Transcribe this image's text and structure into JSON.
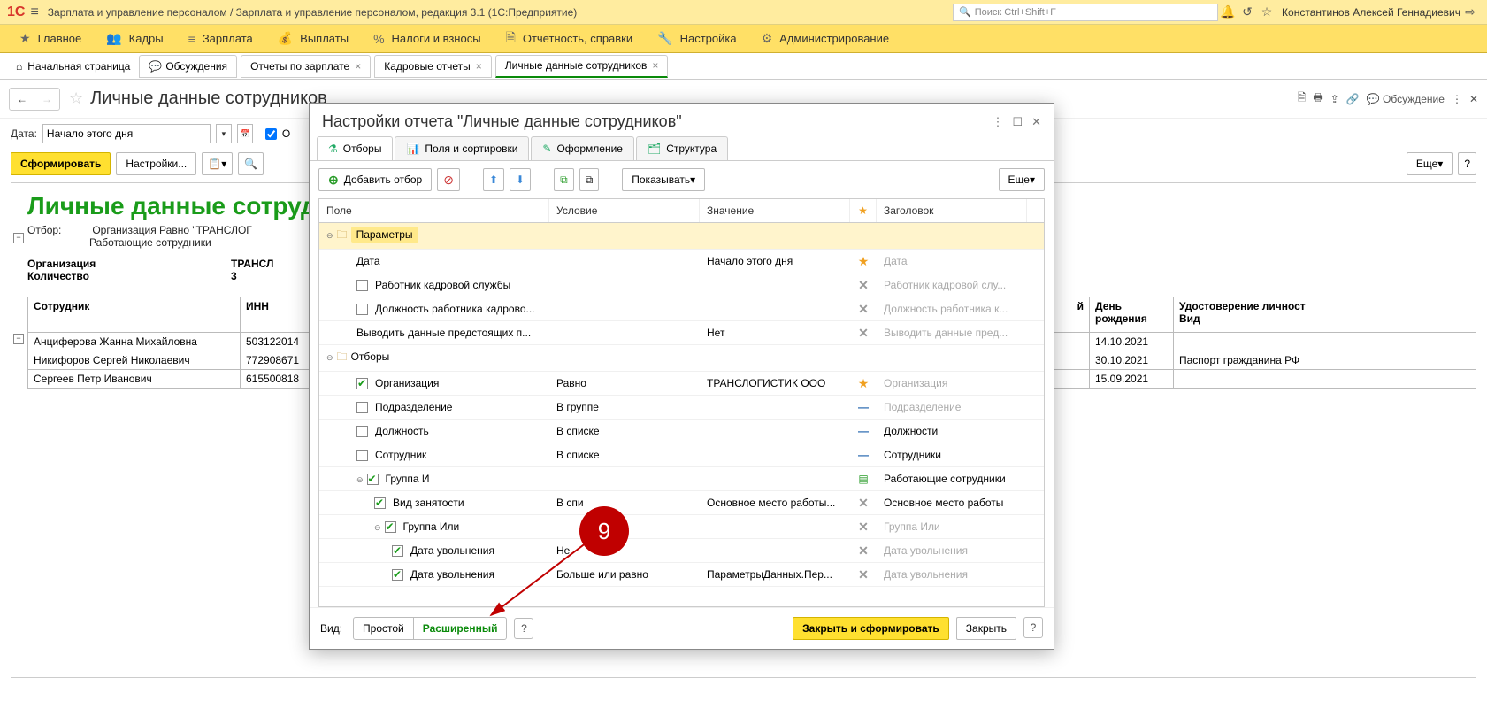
{
  "topbar": {
    "logo": "1C",
    "title": "Зарплата и управление персоналом / Зарплата и управление персоналом, редакция 3.1  (1С:Предприятие)",
    "search_placeholder": "Поиск Ctrl+Shift+F",
    "user": "Константинов Алексей Геннадиевич"
  },
  "nav": {
    "items": [
      {
        "icon": "★",
        "label": "Главное"
      },
      {
        "icon": "👥",
        "label": "Кадры"
      },
      {
        "icon": "≡",
        "label": "Зарплата"
      },
      {
        "icon": "💰",
        "label": "Выплаты"
      },
      {
        "icon": "%",
        "label": "Налоги и взносы"
      },
      {
        "icon": "🗎",
        "label": "Отчетность, справки"
      },
      {
        "icon": "🔧",
        "label": "Настройка"
      },
      {
        "icon": "⚙",
        "label": "Администрирование"
      }
    ]
  },
  "tabs": {
    "home": "Начальная страница",
    "items": [
      {
        "label": "Обсуждения",
        "icon": "💬"
      },
      {
        "label": "Отчеты по зарплате",
        "close": true
      },
      {
        "label": "Кадровые отчеты",
        "close": true
      },
      {
        "label": "Личные данные сотрудников",
        "close": true,
        "active": true
      }
    ]
  },
  "page": {
    "title": "Личные данные сотрудников",
    "chat_label": "Обсуждение",
    "date_label": "Дата:",
    "date_value": "Начало этого дня",
    "checkbox_label": "О",
    "form_btn": "Сформировать",
    "settings_btn": "Настройки...",
    "more_btn": "Еще",
    "help_btn": "?"
  },
  "report": {
    "title": "Личные данные сотрудников",
    "filter_label": "Отбор:",
    "filter_line1": "Организация Равно \"ТРАНСЛОГ",
    "filter_line2": "Работающие сотрудники",
    "org_label": "Организация",
    "org_value": "ТРАНСЛ",
    "count_label": "Количество",
    "count_value": "3",
    "columns": {
      "employee": "Сотрудник",
      "inn": "ИНН",
      "partial": "й",
      "birthday": "День рождения",
      "idtype": "Удостоверение личност",
      "idtype2": "Вид"
    },
    "rows": [
      {
        "name": "Анциферова Жанна Михайловна",
        "inn": "503122014",
        "birthday": "14.10.2021",
        "id": ""
      },
      {
        "name": "Никифоров Сергей Николаевич",
        "inn": "772908671",
        "birthday": "30.10.2021",
        "id": "Паспорт гражданина РФ"
      },
      {
        "name": "Сергеев Петр Иванович",
        "inn": "615500818",
        "birthday": "15.09.2021",
        "id": ""
      }
    ]
  },
  "modal": {
    "title": "Настройки отчета \"Личные данные сотрудников\"",
    "tabs": [
      {
        "icon": "⚗",
        "label": "Отборы",
        "active": true
      },
      {
        "icon": "📊",
        "label": "Поля и сортировки"
      },
      {
        "icon": "✎",
        "label": "Оформление"
      },
      {
        "icon": "🗂",
        "label": "Структура"
      }
    ],
    "toolbar": {
      "add": "Добавить отбор",
      "show": "Показывать",
      "more": "Еще"
    },
    "headers": {
      "field": "Поле",
      "cond": "Условие",
      "value": "Значение",
      "title": "Заголовок"
    },
    "rows": [
      {
        "type": "section",
        "field": "Параметры"
      },
      {
        "indent": 1,
        "field": "Дата",
        "value": "Начало этого дня",
        "star": true,
        "title": "Дата",
        "pale": true
      },
      {
        "indent": 2,
        "chk": false,
        "field": "Работник кадровой службы",
        "x": true,
        "title": "Работник кадровой слу...",
        "pale": true
      },
      {
        "indent": 2,
        "chk": false,
        "field": "Должность работника кадрово...",
        "x": true,
        "title": "Должность работника к...",
        "pale": true
      },
      {
        "indent": 1,
        "field": "Выводить данные предстоящих п...",
        "value": "Нет",
        "x": true,
        "title": "Выводить данные пред...",
        "pale": true
      },
      {
        "type": "section2",
        "field": "Отборы"
      },
      {
        "indent": 2,
        "chk": true,
        "field": "Организация",
        "cond": "Равно",
        "value": "ТРАНСЛОГИСТИК ООО",
        "star": true,
        "title": "Организация",
        "pale": true
      },
      {
        "indent": 2,
        "chk": false,
        "field": "Подразделение",
        "cond": "В группе",
        "dash": true,
        "title": "Подразделение",
        "pale": true
      },
      {
        "indent": 2,
        "chk": false,
        "field": "Должность",
        "cond": "В списке",
        "dash": true,
        "title": "Должности"
      },
      {
        "indent": 2,
        "chk": false,
        "field": "Сотрудник",
        "cond": "В списке",
        "dash": true,
        "title": "Сотрудники"
      },
      {
        "indent": 2,
        "chk": true,
        "tree": "⊖",
        "field": "Группа И",
        "listico": true,
        "title": "Работающие сотрудники"
      },
      {
        "indent": 3,
        "chk": true,
        "field": "Вид занятости",
        "cond": "В спи",
        "value": "Основное место работы...",
        "x": true,
        "title": "Основное место работы"
      },
      {
        "indent": 3,
        "chk": true,
        "tree": "⊖",
        "field": "Группа Или",
        "x": true,
        "title": "Группа Или",
        "pale": true
      },
      {
        "indent": 4,
        "chk": true,
        "field": "Дата увольнения",
        "cond": "Не",
        "x": true,
        "title": "Дата увольнения",
        "pale": true
      },
      {
        "indent": 4,
        "chk": true,
        "field": "Дата увольнения",
        "cond": "Больше или равно",
        "value": "ПараметрыДанных.Пер...",
        "x": true,
        "title": "Дата увольнения",
        "pale": true
      }
    ],
    "footer": {
      "view_label": "Вид:",
      "simple": "Простой",
      "advanced": "Расширенный",
      "close_form": "Закрыть и сформировать",
      "close": "Закрыть"
    }
  },
  "annotation": {
    "num": "9"
  }
}
